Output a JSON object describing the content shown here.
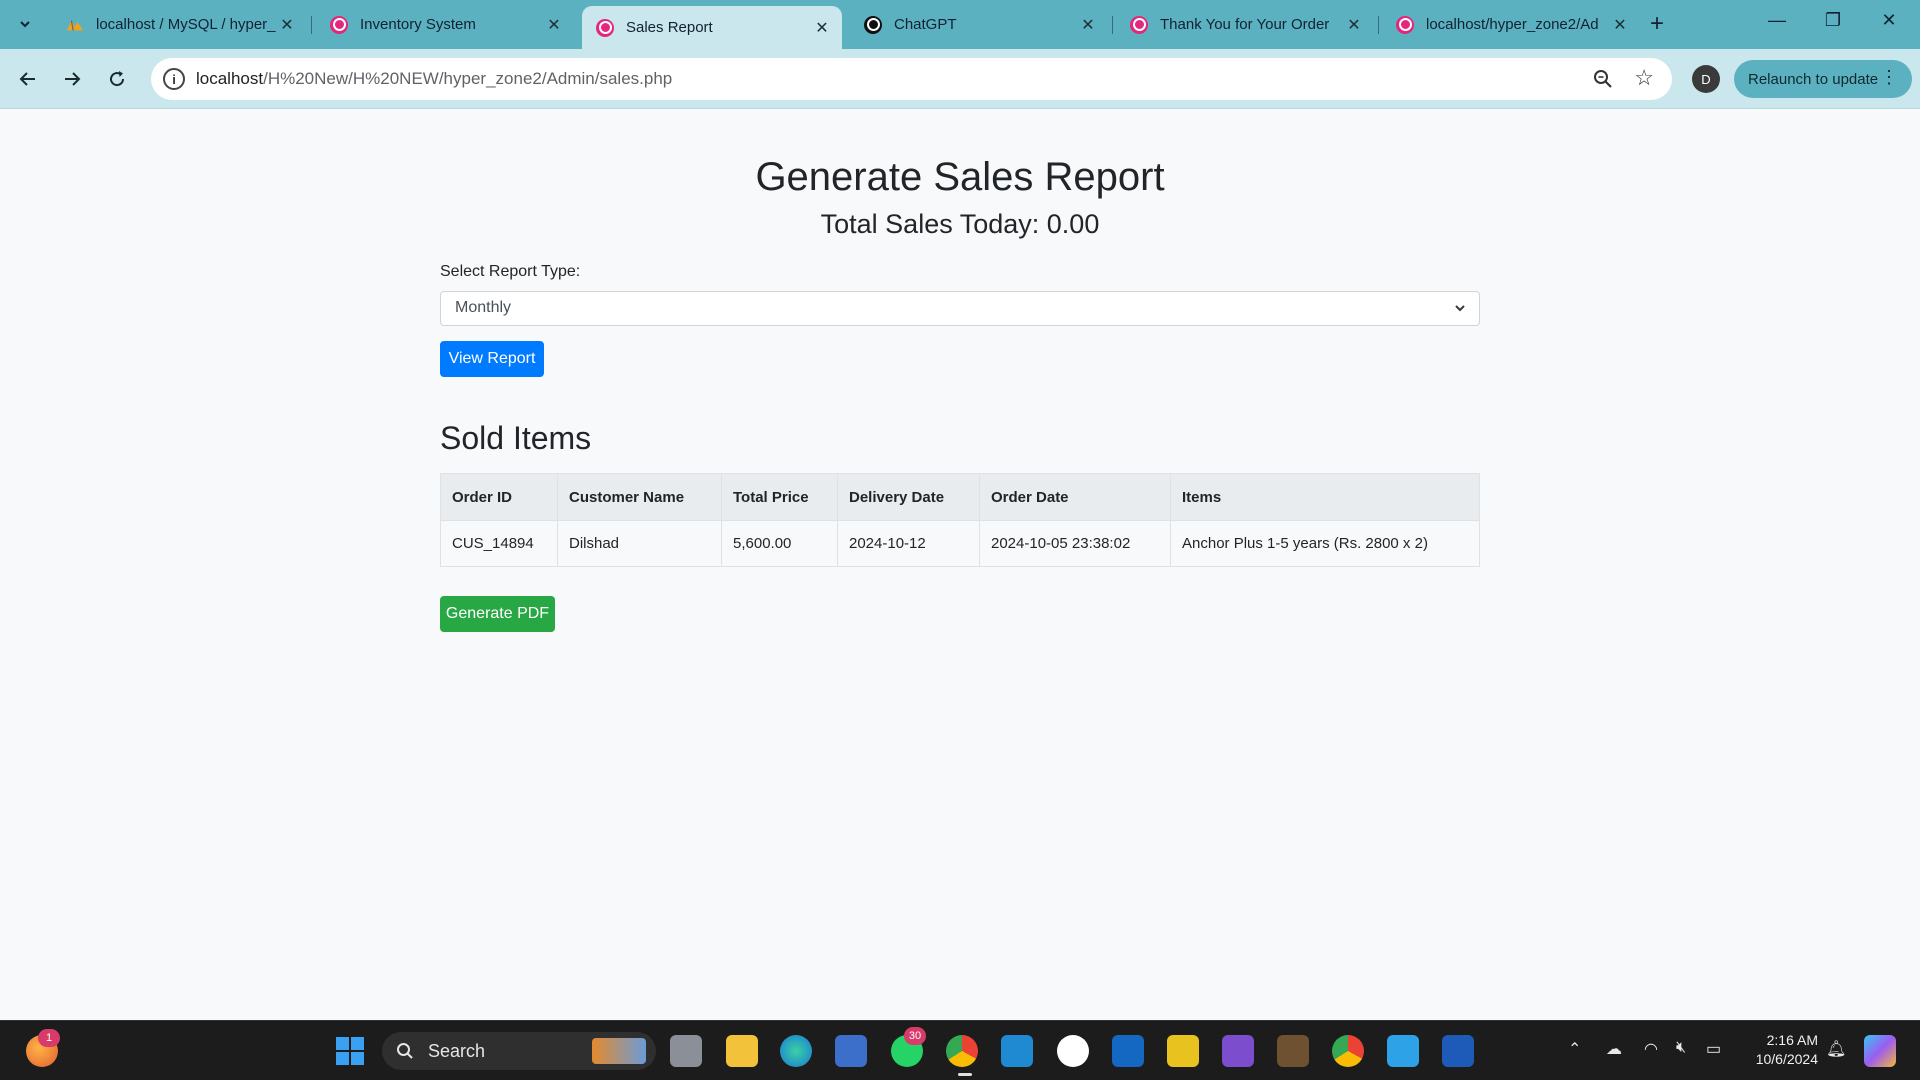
{
  "browser": {
    "tabs": [
      {
        "title": "localhost / MySQL / hyper_",
        "favicon": "phpmyadmin-icon",
        "active": false
      },
      {
        "title": "Inventory System",
        "favicon": "hyperzone-icon",
        "active": false
      },
      {
        "title": "Sales Report",
        "favicon": "hyperzone-icon",
        "active": true
      },
      {
        "title": "ChatGPT",
        "favicon": "chatgpt-icon",
        "active": false
      },
      {
        "title": "Thank You for Your Order",
        "favicon": "hyperzone-icon",
        "active": false
      },
      {
        "title": "localhost/hyper_zone2/Ad",
        "favicon": "hyperzone-icon",
        "active": false
      }
    ],
    "url": {
      "host": "localhost",
      "path": "/H%20New/H%20NEW/hyper_zone2/Admin/sales.php"
    },
    "profile_initial": "D",
    "relaunch_label": "Relaunch to update",
    "colors": {
      "tabstrip": "#5cb1c0",
      "toolbar": "#c9e7ec"
    }
  },
  "page": {
    "title": "Generate Sales Report",
    "total_sales": "Total Sales Today: 0.00",
    "report_type_label": "Select Report Type:",
    "report_type_selected": "Monthly",
    "view_button": "View Report",
    "sold_items_heading": "Sold Items",
    "table": {
      "headers": [
        "Order ID",
        "Customer Name",
        "Total Price",
        "Delivery Date",
        "Order Date",
        "Items"
      ],
      "rows": [
        [
          "CUS_14894",
          "Dilshad",
          "5,600.00",
          "2024-10-12",
          "2024-10-05 23:38:02",
          "Anchor Plus 1-5 years (Rs. 2800 x 2)"
        ]
      ]
    },
    "pdf_button": "Generate PDF",
    "colors": {
      "primary": "#007bff",
      "success": "#28a745"
    }
  },
  "taskbar": {
    "search_label": "Search",
    "whatsapp_badge": "30",
    "notification_badge": "1",
    "time": "2:16 AM",
    "date": "10/6/2024"
  }
}
